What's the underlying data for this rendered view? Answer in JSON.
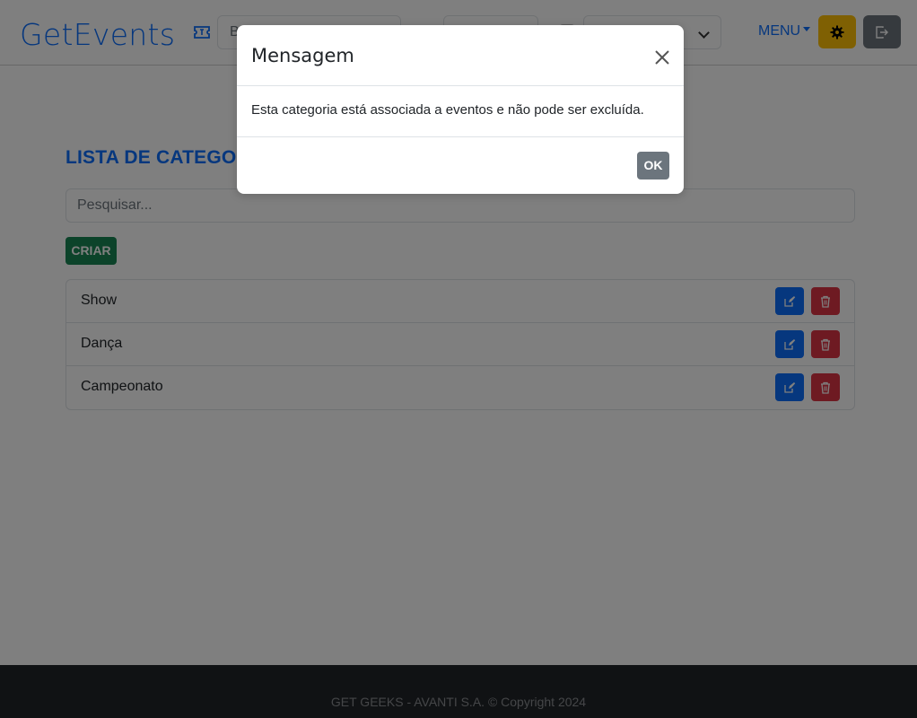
{
  "app": {
    "brand": "GetEvents"
  },
  "navbar": {
    "search_value": "B",
    "date_value": "",
    "select_value": "r",
    "menu_label": "MENU"
  },
  "main": {
    "title": "LISTA DE CATEGORIAS",
    "search_placeholder": "Pesquisar...",
    "create_label": "CRIAR",
    "categories": [
      {
        "name": "Show"
      },
      {
        "name": "Dança"
      },
      {
        "name": "Campeonato"
      }
    ]
  },
  "footer": {
    "text": "GET GEEKS - AVANTI S.A. © Copyright 2024"
  },
  "modal": {
    "title": "Mensagem",
    "message": "Esta categoria está associada a eventos e não pode ser excluída.",
    "ok_label": "OK"
  },
  "colors": {
    "primary": "#0d6efd",
    "success": "#198754",
    "danger": "#dc3545",
    "warning": "#ffc107",
    "secondary": "#6c757d",
    "footer": "#212529"
  },
  "icons": {
    "ticket": "ticket-icon",
    "settings": "gear-icon",
    "logout": "logout-icon",
    "edit": "edit-icon",
    "delete": "trash-icon",
    "close": "close-icon"
  }
}
